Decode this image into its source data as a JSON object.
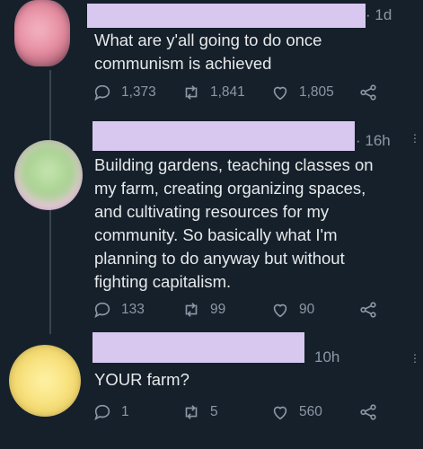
{
  "tweets": [
    {
      "time": "· 1d",
      "text": "What are y'all going to do once\ncommunism is achieved",
      "reply_count": "1,373",
      "retweet_count": "1,841",
      "like_count": "1,805"
    },
    {
      "time": "· 16h",
      "text": "Building gardens, teaching classes on\nmy farm,  creating organizing spaces,\nand cultivating resources for my\ncommunity. So basically what I'm\nplanning to do anyway but without\nfighting capitalism.",
      "reply_count": "133",
      "retweet_count": "99",
      "like_count": "90"
    },
    {
      "time": "10h",
      "text": "YOUR farm?",
      "reply_count": "1",
      "retweet_count": "5",
      "like_count": "560"
    }
  ],
  "icons": {
    "reply": "reply-icon",
    "retweet": "retweet-icon",
    "like": "heart-icon",
    "share": "share-icon",
    "more": "more-icon"
  },
  "colors": {
    "background": "#15202b",
    "text": "#e7e9ea",
    "muted": "#8b98a5",
    "name_redaction": "#d8c8f0"
  }
}
